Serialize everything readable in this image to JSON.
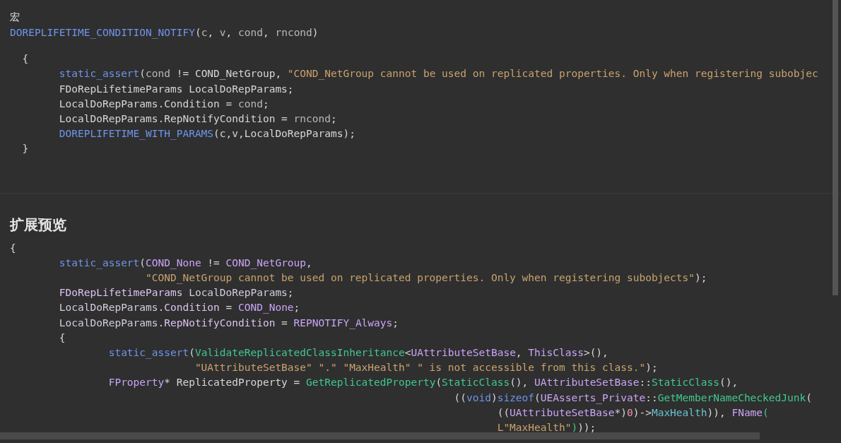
{
  "sections": [
    {
      "heading": {
        "text": "宏",
        "kind": "small"
      },
      "signature": [
        {
          "text": "DOREPLIFETIME_CONDITION_NOTIFY",
          "kind": "macro"
        },
        {
          "text": "(",
          "kind": "plain"
        },
        {
          "text": "c",
          "kind": "param"
        },
        {
          "text": ", ",
          "kind": "plain"
        },
        {
          "text": "v",
          "kind": "param"
        },
        {
          "text": ", ",
          "kind": "plain"
        },
        {
          "text": "cond",
          "kind": "param"
        },
        {
          "text": ", ",
          "kind": "plain"
        },
        {
          "text": "rncond",
          "kind": "param"
        },
        {
          "text": ")",
          "kind": "plain"
        }
      ],
      "lines": [
        [
          {
            "text": "  {",
            "kind": "plain"
          }
        ],
        [
          {
            "text": "        static_assert",
            "kind": "macro"
          },
          {
            "text": "(",
            "kind": "plain"
          },
          {
            "text": "cond",
            "kind": "param"
          },
          {
            "text": " != COND_NetGroup, ",
            "kind": "plain"
          },
          {
            "text": "\"COND_NetGroup cannot be used on replicated properties. Only when registering subobjec",
            "kind": "string"
          }
        ],
        [
          {
            "text": "        FDoRepLifetimeParams LocalDoRepParams;",
            "kind": "plain"
          }
        ],
        [
          {
            "text": "        LocalDoRepParams.Condition = ",
            "kind": "plain"
          },
          {
            "text": "cond",
            "kind": "param"
          },
          {
            "text": ";",
            "kind": "plain"
          }
        ],
        [
          {
            "text": "        LocalDoRepParams.RepNotifyCondition = ",
            "kind": "plain"
          },
          {
            "text": "rncond",
            "kind": "param"
          },
          {
            "text": ";",
            "kind": "plain"
          }
        ],
        [
          {
            "text": "        DOREPLIFETIME_WITH_PARAMS",
            "kind": "macro"
          },
          {
            "text": "(c,v,LocalDoRepParams);",
            "kind": "plain"
          }
        ],
        [
          {
            "text": "  }",
            "kind": "plain"
          }
        ]
      ]
    },
    {
      "heading": {
        "text": "扩展预览",
        "kind": "title"
      },
      "lines": [
        [
          {
            "text": "{",
            "kind": "plain"
          }
        ],
        [
          {
            "text": "        static_assert",
            "kind": "macro"
          },
          {
            "text": "(",
            "kind": "plain"
          },
          {
            "text": "COND_None",
            "kind": "type"
          },
          {
            "text": " != ",
            "kind": "plain"
          },
          {
            "text": "COND_NetGroup",
            "kind": "type"
          },
          {
            "text": ",",
            "kind": "plain"
          }
        ],
        [
          {
            "text": "                      \"COND_NetGroup cannot be used on replicated properties. Only when registering subobjects\"",
            "kind": "string"
          },
          {
            "text": ");",
            "kind": "plain"
          }
        ],
        [
          {
            "text": "        FDoRepLifetimeParams",
            "kind": "member"
          },
          {
            "text": " LocalDoRepParams;",
            "kind": "local"
          }
        ],
        [
          {
            "text": "        LocalDoRepParams",
            "kind": "local"
          },
          {
            "text": ".",
            "kind": "plain"
          },
          {
            "text": "Condition",
            "kind": "member"
          },
          {
            "text": " = ",
            "kind": "plain"
          },
          {
            "text": "COND_None",
            "kind": "type"
          },
          {
            "text": ";",
            "kind": "plain"
          }
        ],
        [
          {
            "text": "        LocalDoRepParams",
            "kind": "local"
          },
          {
            "text": ".",
            "kind": "plain"
          },
          {
            "text": "RepNotifyCondition",
            "kind": "member"
          },
          {
            "text": " = ",
            "kind": "plain"
          },
          {
            "text": "REPNOTIFY_Always",
            "kind": "type"
          },
          {
            "text": ";",
            "kind": "plain"
          }
        ],
        [
          {
            "text": "        {",
            "kind": "plain"
          }
        ],
        [
          {
            "text": "                static_assert",
            "kind": "macro"
          },
          {
            "text": "(",
            "kind": "plain"
          },
          {
            "text": "ValidateReplicatedClassInheritance",
            "kind": "func"
          },
          {
            "text": "<",
            "kind": "plain"
          },
          {
            "text": "UAttributeSetBase",
            "kind": "type"
          },
          {
            "text": ", ",
            "kind": "plain"
          },
          {
            "text": "ThisClass",
            "kind": "type"
          },
          {
            "text": ">(),",
            "kind": "plain"
          }
        ],
        [
          {
            "text": "                              \"UAttributeSetBase\" \".\" \"MaxHealth\" \" is not accessible from this class.\"",
            "kind": "string"
          },
          {
            "text": ");",
            "kind": "plain"
          }
        ],
        [
          {
            "text": "                FProperty",
            "kind": "type"
          },
          {
            "text": "* ReplicatedProperty = ",
            "kind": "plain"
          },
          {
            "text": "GetReplicatedProperty",
            "kind": "func"
          },
          {
            "text": "(",
            "kind": "plain"
          },
          {
            "text": "StaticClass",
            "kind": "func"
          },
          {
            "text": "(), ",
            "kind": "plain"
          },
          {
            "text": "UAttributeSetBase",
            "kind": "type"
          },
          {
            "text": "::",
            "kind": "plain"
          },
          {
            "text": "StaticClass",
            "kind": "func"
          },
          {
            "text": "(),",
            "kind": "plain"
          }
        ],
        [
          {
            "text": "                                                                        ((",
            "kind": "plain"
          },
          {
            "text": "void",
            "kind": "keyword"
          },
          {
            "text": ")",
            "kind": "plain"
          },
          {
            "text": "sizeof",
            "kind": "macro"
          },
          {
            "text": "(",
            "kind": "plain"
          },
          {
            "text": "UEAsserts_Private",
            "kind": "type"
          },
          {
            "text": "::",
            "kind": "plain"
          },
          {
            "text": "GetMemberNameCheckedJunk",
            "kind": "func"
          },
          {
            "text": "(",
            "kind": "plain"
          }
        ],
        [
          {
            "text": "                                                                               ((",
            "kind": "plain"
          },
          {
            "text": "UAttributeSetBase",
            "kind": "type"
          },
          {
            "text": "*)",
            "kind": "plain"
          },
          {
            "text": "0",
            "kind": "number"
          },
          {
            "text": ")->",
            "kind": "plain"
          },
          {
            "text": "MaxHealth",
            "kind": "field"
          },
          {
            "text": ")), ",
            "kind": "plain"
          },
          {
            "text": "FName",
            "kind": "type"
          },
          {
            "text": "(",
            "kind": "func"
          }
        ],
        [
          {
            "text": "                                                                               L\"MaxHealth\"",
            "kind": "string"
          },
          {
            "text": ")",
            "kind": "func"
          },
          {
            "text": "));",
            "kind": "plain"
          }
        ]
      ]
    }
  ]
}
